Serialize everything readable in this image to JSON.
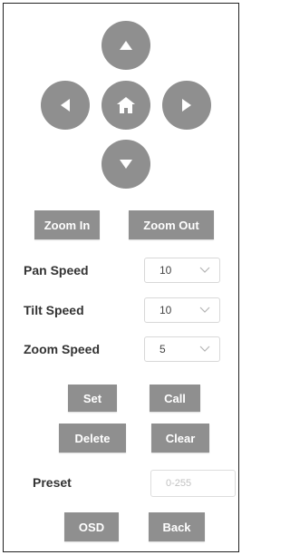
{
  "ptz_pad": {
    "up_icon": "arrow-up-icon",
    "left_icon": "arrow-left-icon",
    "home_icon": "home-icon",
    "right_icon": "arrow-right-icon",
    "down_icon": "arrow-down-icon"
  },
  "zoom": {
    "zoom_in_label": "Zoom In",
    "zoom_out_label": "Zoom Out"
  },
  "speeds": {
    "pan": {
      "label": "Pan Speed",
      "value": "10"
    },
    "tilt": {
      "label": "Tilt Speed",
      "value": "10"
    },
    "zoom": {
      "label": "Zoom Speed",
      "value": "5"
    }
  },
  "preset_actions": {
    "set_label": "Set",
    "call_label": "Call",
    "delete_label": "Delete",
    "clear_label": "Clear"
  },
  "preset": {
    "label": "Preset",
    "value": "",
    "placeholder": "0-255"
  },
  "footer": {
    "osd_label": "OSD",
    "back_label": "Back"
  },
  "colors": {
    "button_gray": "#8f8f8f",
    "border": "#222222"
  }
}
